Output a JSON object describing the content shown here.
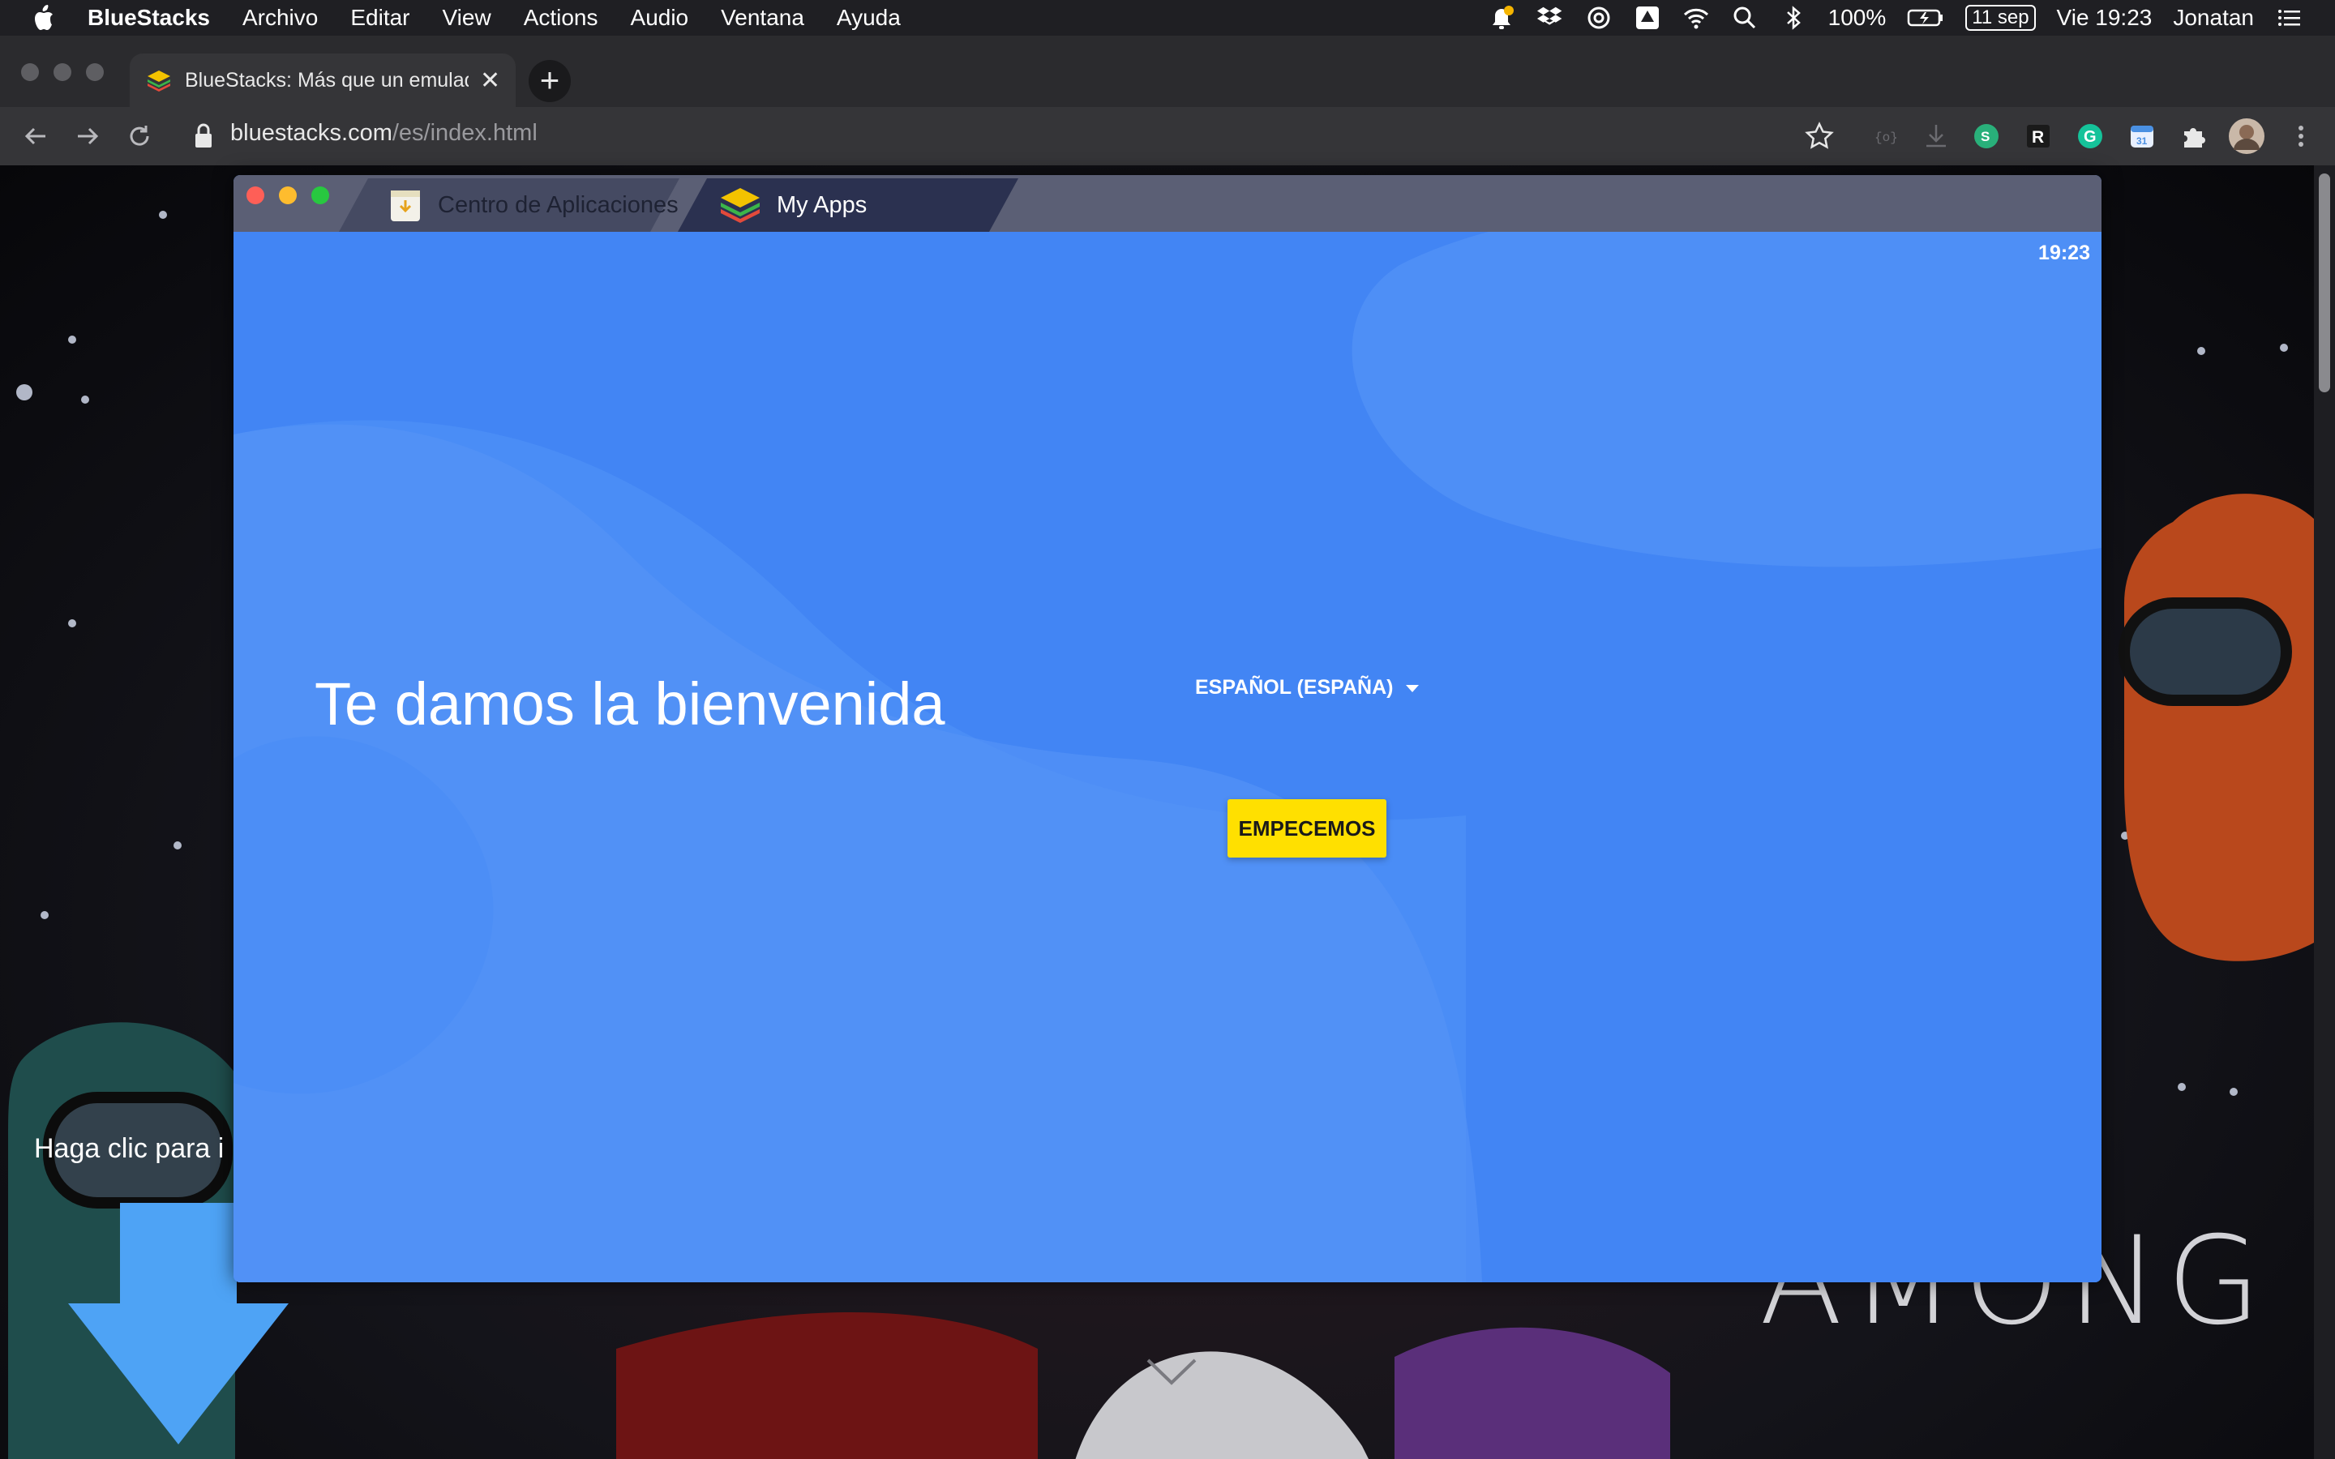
{
  "menubar": {
    "app_name": "BlueStacks",
    "items": [
      "Archivo",
      "Editar",
      "View",
      "Actions",
      "Audio",
      "Ventana",
      "Ayuda"
    ],
    "status_icons": [
      "notification-icon",
      "dropbox-icon",
      "creative-cloud-icon",
      "google-drive-icon",
      "wifi-icon",
      "spotlight-search-icon",
      "bluetooth-icon"
    ],
    "battery": "100%",
    "date": "11 sep",
    "clock": "Vie 19:23",
    "user": "Jonatan"
  },
  "browser": {
    "tab_title": "BlueStacks: Más que un emulador",
    "url_domain": "bluestacks.com",
    "url_path": "/es/index.html",
    "extension_icons": [
      "bookmark-star-icon",
      "reader-mode-icon",
      "download-icon",
      "grammarly-green-icon",
      "r-extension-icon",
      "grammarly-icon",
      "calendar-extension-icon",
      "extensions-puzzle-icon",
      "profile-avatar",
      "more-menu-icon"
    ]
  },
  "page": {
    "download_text": "Haga clic para i",
    "game_logo": "AMONG US"
  },
  "bluestacks": {
    "tabs": [
      {
        "label": "Centro de Aplicaciones",
        "icon": "app-center-icon"
      },
      {
        "label": "My Apps",
        "icon": "bluestacks-logo-icon"
      }
    ],
    "clock": "19:23",
    "welcome_title": "Te damos la bienvenida",
    "language": "ESPAÑOL (ESPAÑA)",
    "start_button": "EMPECEMOS"
  },
  "colors": {
    "bluestacks_blue": "#4285f4",
    "start_button_yellow": "#ffe000",
    "titlebar": "#5b5f75"
  }
}
